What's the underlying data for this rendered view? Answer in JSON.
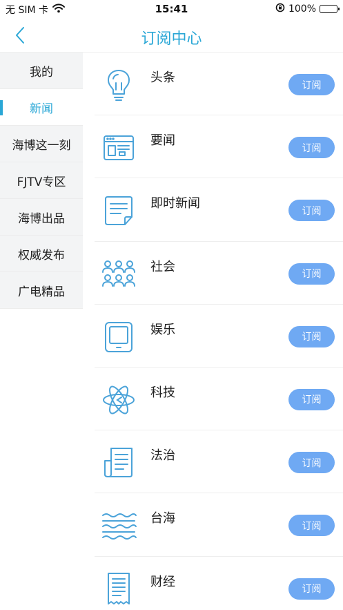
{
  "status": {
    "carrier": "无 SIM 卡",
    "time": "15:41",
    "battery": "100%"
  },
  "nav": {
    "title": "订阅中心"
  },
  "sidebar": {
    "items": [
      {
        "label": "我的",
        "active": false
      },
      {
        "label": "新闻",
        "active": true
      },
      {
        "label": "海博这一刻",
        "active": false
      },
      {
        "label": "FJTV专区",
        "active": false
      },
      {
        "label": "海博出品",
        "active": false
      },
      {
        "label": "权威发布",
        "active": false
      },
      {
        "label": "广电精品",
        "active": false
      }
    ]
  },
  "channels": [
    {
      "title": "头条",
      "icon": "lightbulb-icon",
      "button": "订阅"
    },
    {
      "title": "要闻",
      "icon": "browser-window-icon",
      "button": "订阅"
    },
    {
      "title": "即时新闻",
      "icon": "document-icon",
      "button": "订阅"
    },
    {
      "title": "社会",
      "icon": "people-group-icon",
      "button": "订阅"
    },
    {
      "title": "娱乐",
      "icon": "tablet-icon",
      "button": "订阅"
    },
    {
      "title": "科技",
      "icon": "atom-icon",
      "button": "订阅"
    },
    {
      "title": "法治",
      "icon": "newspaper-icon",
      "button": "订阅"
    },
    {
      "title": "台海",
      "icon": "waves-icon",
      "button": "订阅"
    },
    {
      "title": "财经",
      "icon": "receipt-icon",
      "button": "订阅"
    }
  ],
  "colors": {
    "accent": "#2aa7d6",
    "button": "#6fa9f3",
    "icon": "#4ba3d9",
    "sidebar_bg": "#f3f4f5"
  }
}
